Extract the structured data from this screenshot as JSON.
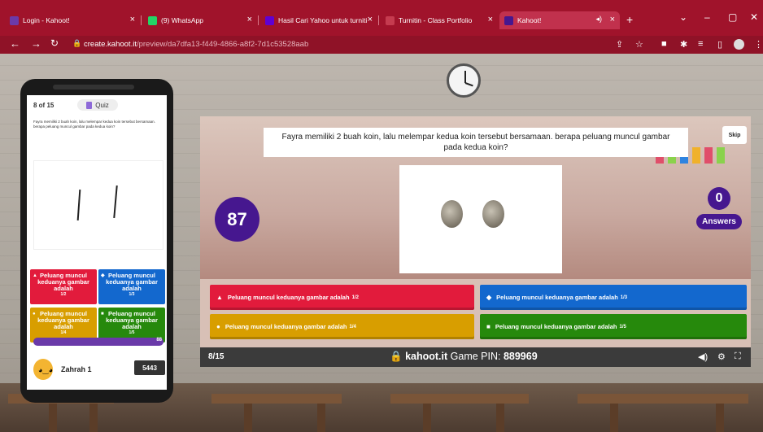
{
  "tabs": [
    {
      "title": "Login - Kahoot!",
      "favicon_color": "#6b3aa9",
      "active": false
    },
    {
      "title": "(9) WhatsApp",
      "favicon_color": "#25d366",
      "active": false
    },
    {
      "title": "Hasil Cari Yahoo untuk turniti",
      "favicon_color": "#6001d2",
      "active": false
    },
    {
      "title": "Turnitin - Class Portfolio",
      "favicon_color": "#c53b4f",
      "active": false
    },
    {
      "title": "Kahoot!",
      "favicon_color": "#46178f",
      "active": true
    }
  ],
  "address_bar": {
    "domain": "create.kahoot.it",
    "path": "/preview/da7dfa13-f449-4866-a8f2-7d1c53528aab"
  },
  "phone": {
    "progress": "8 of 15",
    "badge": "Quiz",
    "question": "Fayra memiliki 2 buah koin, lalu melempar kedua koin tersebut bersamaan. berapa peluang muncul gambar pada kedua koin?",
    "answers": [
      {
        "text": "Peluang muncul keduanya gambar adalah",
        "frac": "1/2",
        "color": "#e21b3c",
        "shape": "▲"
      },
      {
        "text": "Peluang muncul keduanya gambar adalah",
        "frac": "1/3",
        "color": "#1368ce",
        "shape": "◆"
      },
      {
        "text": "Peluang muncul keduanya gambar adalah",
        "frac": "1/4",
        "color": "#d89e00",
        "shape": "●"
      },
      {
        "text": "Peluang muncul keduanya gambar adalah",
        "frac": "1/5",
        "color": "#26890c",
        "shape": "■"
      }
    ],
    "score_streak": "88",
    "player_name": "Zahrah 1",
    "player_points": "5443"
  },
  "board": {
    "question": "Fayra memiliki 2 buah koin, lalu melempar kedua koin tersebut bersamaan. berapa peluang muncul gambar pada kedua koin?",
    "skip_label": "Skip",
    "timer": "87",
    "answers_count": "0",
    "answers_label": "Answers",
    "answers": [
      {
        "text": "Peluang muncul keduanya gambar adalah",
        "frac": "1/2",
        "color": "#e21b3c",
        "shape": "▲"
      },
      {
        "text": "Peluang muncul keduanya gambar adalah",
        "frac": "1/3",
        "color": "#1368ce",
        "shape": "◆"
      },
      {
        "text": "Peluang muncul keduanya gambar adalah",
        "frac": "1/4",
        "color": "#d89e00",
        "shape": "●"
      },
      {
        "text": "Peluang muncul keduanya gambar adalah",
        "frac": "1/5",
        "color": "#26890c",
        "shape": "■"
      }
    ],
    "footer": {
      "progress": "8/15",
      "site": "kahoot.it",
      "pin_label": "Game PIN:",
      "pin": "889969"
    }
  }
}
